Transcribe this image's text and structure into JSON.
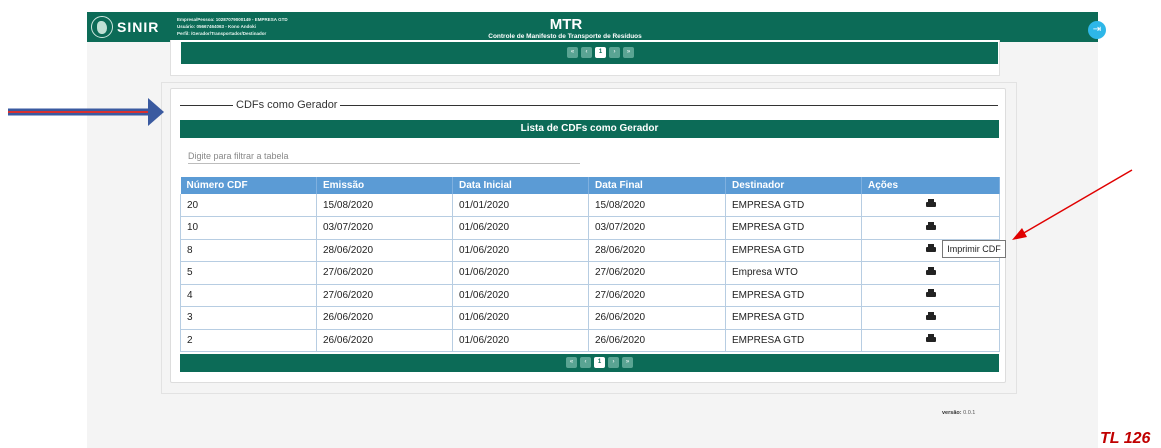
{
  "header": {
    "logo_text": "SINIR",
    "user_lines": [
      "Empresa/Pessoa: 10287079000149 - EMPRESA GTD",
      "Usuário: 05667464063 - Kono Andoki",
      "Perfil: /Gerador/Transportador/Destinador"
    ],
    "title": "MTR",
    "subtitle": "Controle de Manifesto de Transporte de Resíduos",
    "exit_icon": "exit-icon"
  },
  "pager": {
    "current_page": "1",
    "first_icon": "«",
    "prev_icon": "‹",
    "next_icon": "›",
    "last_icon": "»"
  },
  "section": {
    "legend": "CDFs como Gerador",
    "list_title": "Lista de CDFs como Gerador",
    "filter_placeholder": "Digite para filtrar a tabela"
  },
  "table": {
    "columns": [
      "Número CDF",
      "Emissão",
      "Data Inicial",
      "Data Final",
      "Destinador",
      "Ações"
    ],
    "rows": [
      [
        "20",
        "15/08/2020",
        "01/01/2020",
        "15/08/2020",
        "EMPRESA GTD"
      ],
      [
        "10",
        "03/07/2020",
        "01/06/2020",
        "03/07/2020",
        "EMPRESA GTD"
      ],
      [
        "8",
        "28/06/2020",
        "01/06/2020",
        "28/06/2020",
        "EMPRESA GTD"
      ],
      [
        "5",
        "27/06/2020",
        "01/06/2020",
        "27/06/2020",
        "Empresa WTO"
      ],
      [
        "4",
        "27/06/2020",
        "01/06/2020",
        "27/06/2020",
        "EMPRESA GTD"
      ],
      [
        "3",
        "26/06/2020",
        "01/06/2020",
        "26/06/2020",
        "EMPRESA GTD"
      ],
      [
        "2",
        "26/06/2020",
        "01/06/2020",
        "26/06/2020",
        "EMPRESA GTD"
      ]
    ],
    "action_icon": "printer-icon"
  },
  "tooltip": "Imprimir CDF",
  "version": {
    "label": "versão:",
    "value": "0.0.1"
  },
  "page_label": "TL 126",
  "colors": {
    "primary_green": "#0c6b57",
    "table_header_blue": "#5b9bd5",
    "annotation_red": "#e00000",
    "annotation_blue_arrow": "#3a5aa0"
  }
}
